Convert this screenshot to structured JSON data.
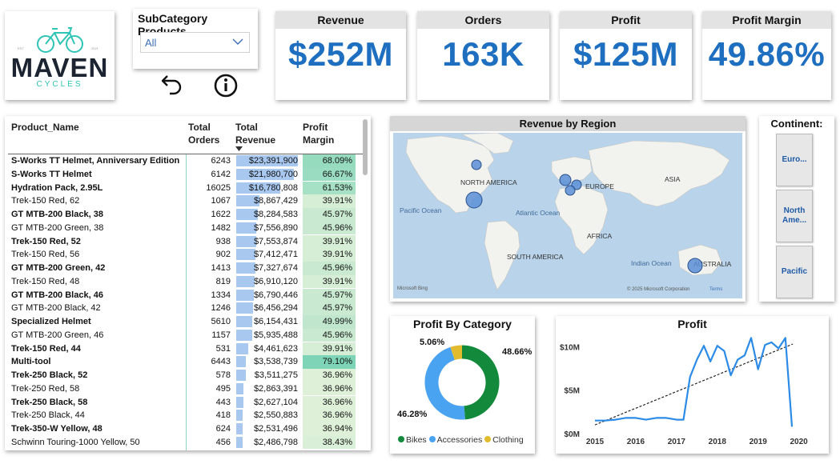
{
  "logo": {
    "wordmark": "MAVEN",
    "sub": "CYCLES",
    "est_left": "EST",
    "est_right": "2021"
  },
  "slicer": {
    "title": "SubCategory Products",
    "selected": "All"
  },
  "buttons": {
    "back": "back-arrow-icon",
    "info": "info-icon"
  },
  "kpis": [
    {
      "title": "Revenue",
      "value": "$252M"
    },
    {
      "title": "Orders",
      "value": "163K"
    },
    {
      "title": "Profit",
      "value": "$125M"
    },
    {
      "title": "Profit Margin",
      "value": "49.86%"
    }
  ],
  "table": {
    "headers": {
      "product": "Product_Name",
      "orders": "Total\nOrders",
      "revenue": "Total\nRevenue",
      "margin": "Profit\nMargin"
    },
    "rows": [
      {
        "name": "S-Works TT Helmet, Anniversary Edition",
        "orders": "6243",
        "revenue": "$23,391,900",
        "margin": "68.09%",
        "rev": 23391900,
        "pm": 68.09
      },
      {
        "name": "S-Works TT Helmet",
        "orders": "6142",
        "revenue": "$21,980,700",
        "margin": "66.67%",
        "rev": 21980700,
        "pm": 66.67
      },
      {
        "name": "Hydration Pack, 2.95L",
        "orders": "16025",
        "revenue": "$16,780,808",
        "margin": "61.53%",
        "rev": 16780808,
        "pm": 61.53
      },
      {
        "name": "Trek-150 Red, 62",
        "orders": "1067",
        "revenue": "$8,867,429",
        "margin": "39.91%",
        "rev": 8867429,
        "pm": 39.91
      },
      {
        "name": "GT MTB-200 Black, 38",
        "orders": "1622",
        "revenue": "$8,284,583",
        "margin": "45.97%",
        "rev": 8284583,
        "pm": 45.97
      },
      {
        "name": "GT MTB-200 Green, 38",
        "orders": "1482",
        "revenue": "$7,556,890",
        "margin": "45.96%",
        "rev": 7556890,
        "pm": 45.96
      },
      {
        "name": "Trek-150 Red, 52",
        "orders": "938",
        "revenue": "$7,553,874",
        "margin": "39.91%",
        "rev": 7553874,
        "pm": 39.91
      },
      {
        "name": "Trek-150 Red, 56",
        "orders": "902",
        "revenue": "$7,412,471",
        "margin": "39.91%",
        "rev": 7412471,
        "pm": 39.91
      },
      {
        "name": "GT MTB-200 Green, 42",
        "orders": "1413",
        "revenue": "$7,327,674",
        "margin": "45.96%",
        "rev": 7327674,
        "pm": 45.96
      },
      {
        "name": "Trek-150 Red, 48",
        "orders": "819",
        "revenue": "$6,910,120",
        "margin": "39.91%",
        "rev": 6910120,
        "pm": 39.91
      },
      {
        "name": "GT MTB-200 Black, 46",
        "orders": "1334",
        "revenue": "$6,790,446",
        "margin": "45.97%",
        "rev": 6790446,
        "pm": 45.97
      },
      {
        "name": "GT MTB-200 Black, 42",
        "orders": "1246",
        "revenue": "$6,456,294",
        "margin": "45.97%",
        "rev": 6456294,
        "pm": 45.97
      },
      {
        "name": "Specialized Helmet",
        "orders": "5610",
        "revenue": "$6,154,431",
        "margin": "49.99%",
        "rev": 6154431,
        "pm": 49.99
      },
      {
        "name": "GT MTB-200 Green, 46",
        "orders": "1157",
        "revenue": "$5,935,488",
        "margin": "45.96%",
        "rev": 5935488,
        "pm": 45.96
      },
      {
        "name": "Trek-150 Red, 44",
        "orders": "531",
        "revenue": "$4,461,623",
        "margin": "39.91%",
        "rev": 4461623,
        "pm": 39.91
      },
      {
        "name": "Multi-tool",
        "orders": "6443",
        "revenue": "$3,538,739",
        "margin": "79.10%",
        "rev": 3538739,
        "pm": 79.1
      },
      {
        "name": "Trek-250 Black, 52",
        "orders": "578",
        "revenue": "$3,511,275",
        "margin": "36.96%",
        "rev": 3511275,
        "pm": 36.96
      },
      {
        "name": "Trek-250 Red, 58",
        "orders": "495",
        "revenue": "$2,863,391",
        "margin": "36.96%",
        "rev": 2863391,
        "pm": 36.96
      },
      {
        "name": "Trek-250 Black, 58",
        "orders": "443",
        "revenue": "$2,627,104",
        "margin": "36.96%",
        "rev": 2627104,
        "pm": 36.96
      },
      {
        "name": "Trek-250 Black, 44",
        "orders": "418",
        "revenue": "$2,550,883",
        "margin": "36.96%",
        "rev": 2550883,
        "pm": 36.96
      },
      {
        "name": "Trek-350-W Yellow, 48",
        "orders": "624",
        "revenue": "$2,531,496",
        "margin": "36.94%",
        "rev": 2531496,
        "pm": 36.94
      },
      {
        "name": "Schwinn Touring-1000 Yellow, 50",
        "orders": "456",
        "revenue": "$2,486,798",
        "margin": "38.43%",
        "rev": 2486798,
        "pm": 38.43
      }
    ]
  },
  "map": {
    "title": "Revenue by Region",
    "labels": {
      "na": "NORTH AMERICA",
      "sa": "SOUTH AMERICA",
      "eu": "EUROPE",
      "asia": "ASIA",
      "africa": "AFRICA",
      "aus": "AUSTRALIA",
      "pacific": "Pacific Ocean",
      "atlantic": "Atlantic Ocean",
      "indian": "Indian Ocean"
    },
    "bing": "Microsoft Bing",
    "copyright": "© 2025 Microsoft Corporation",
    "terms": "Terms",
    "color_bubble": "#5b8fd6"
  },
  "continent": {
    "title": "Continent:",
    "items": [
      "Euro...",
      "North\nAme...",
      "Pacific"
    ]
  },
  "donut": {
    "title": "Profit By Category",
    "segments": [
      {
        "name": "Bikes",
        "pct": 48.66,
        "label": "48.66%",
        "color": "#138a3b"
      },
      {
        "name": "Accessories",
        "pct": 46.28,
        "label": "46.28%",
        "color": "#4aa3f0"
      },
      {
        "name": "Clothing",
        "pct": 5.06,
        "label": "5.06%",
        "color": "#e2bb2e"
      }
    ]
  },
  "chart_data": {
    "type": "line",
    "title": "Profit",
    "x_ticks": [
      "2015",
      "2016",
      "2017",
      "2018",
      "2019",
      "2020"
    ],
    "y_ticks": [
      "$0M",
      "$5M",
      "$10M"
    ],
    "ylim": [
      0,
      11.5
    ],
    "series": [
      {
        "values": [
          [
            2015,
            1.5
          ],
          [
            2015.25,
            1.5
          ],
          [
            2015.5,
            1.6
          ],
          [
            2015.75,
            1.8
          ],
          [
            2016,
            1.8
          ],
          [
            2016.25,
            1.6
          ],
          [
            2016.5,
            1.8
          ],
          [
            2016.75,
            1.8
          ],
          [
            2017,
            1.6
          ],
          [
            2017.17,
            1.6
          ],
          [
            2017.33,
            6.5
          ],
          [
            2017.5,
            8.5
          ],
          [
            2017.67,
            10.1
          ],
          [
            2017.83,
            8.3
          ],
          [
            2018,
            10.1
          ],
          [
            2018.17,
            9.5
          ],
          [
            2018.33,
            6.7
          ],
          [
            2018.5,
            8.5
          ],
          [
            2018.67,
            9.0
          ],
          [
            2018.83,
            11.0
          ],
          [
            2019,
            7.4
          ],
          [
            2019.17,
            10.2
          ],
          [
            2019.33,
            10.5
          ],
          [
            2019.5,
            9.8
          ],
          [
            2019.67,
            11.0
          ],
          [
            2019.83,
            0.8
          ]
        ]
      }
    ],
    "trend": {
      "from": [
        2015,
        1.0
      ],
      "to": [
        2019.85,
        10.3
      ]
    }
  }
}
